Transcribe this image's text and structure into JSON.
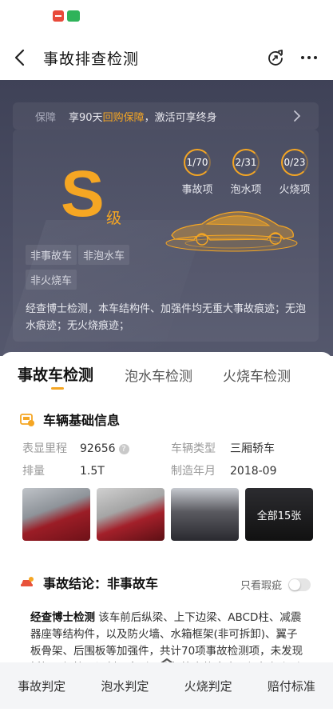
{
  "nav": {
    "title": "事故排查检测"
  },
  "guarantee": {
    "label": "保障",
    "text_pre": "享90天",
    "highlight": "回购保障",
    "text_post": "，激活可享终身"
  },
  "grade": {
    "letter": "S",
    "suffix": "级"
  },
  "stats": [
    {
      "value": "1/70",
      "label": "事故项",
      "progress": 0.014
    },
    {
      "value": "2/31",
      "label": "泡水项",
      "progress": 0.065
    },
    {
      "value": "0/23",
      "label": "火烧项",
      "progress": 0.0
    }
  ],
  "tags": [
    "非事故车",
    "非泡水车",
    "非火烧车"
  ],
  "summary": "经查博士检测，本车结构件、加强件均无重大事故痕迹；无泡水痕迹；无火烧痕迹；",
  "tabs": [
    {
      "label": "事故车检测",
      "active": true
    },
    {
      "label": "泡水车检测",
      "active": false
    },
    {
      "label": "火烧车检测",
      "active": false
    }
  ],
  "vehicle_info": {
    "title": "车辆基础信息",
    "mileage_label": "表显里程",
    "mileage_value": "92656",
    "type_label": "车辆类型",
    "type_value": "三厢轿车",
    "displacement_label": "排量",
    "displacement_value": "1.5T",
    "date_label": "制造年月",
    "date_value": "2018-09",
    "photos_more": "全部15张"
  },
  "conclusion": {
    "title": "事故结论：非事故车",
    "toggle_label": "只看瑕疵",
    "detail_brand": "经查博士检测",
    "detail_text": "该车前后纵梁、上下边梁、ABCD柱、减震器座等结构件，以及防火墙、水箱框架(非可拆卸)、翼子板骨架、后围板等加强件，共计70项事故检测项，未发现拆卸、焊接、切割、变形、修复等事故痕迹，仅存在个别轻微瑕疵。"
  },
  "bottom_bar": [
    "事故判定",
    "泡水判定",
    "火烧判定",
    "赔付标准"
  ],
  "colors": {
    "accent": "#f5a623",
    "hero_bg": "#44475c",
    "bottom_bar": "#f4f5f7"
  }
}
